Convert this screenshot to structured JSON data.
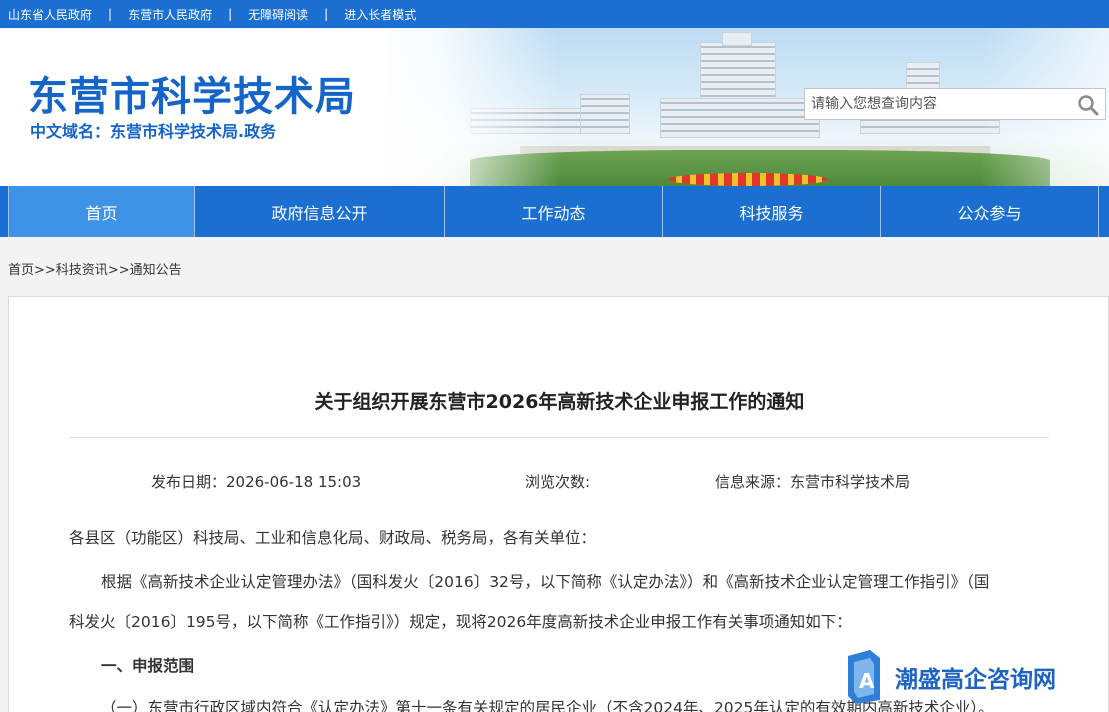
{
  "topbar": {
    "links": [
      "山东省人民政府",
      "东营市人民政府",
      "无障碍阅读",
      "进入长者模式"
    ],
    "separator": "|"
  },
  "header": {
    "site_title": "东营市科学技术局",
    "domain_label": "中文域名：东营市科学技术局.政务",
    "search_placeholder": "请输入您想查询内容"
  },
  "nav": {
    "items": [
      {
        "label": "首页",
        "active": true
      },
      {
        "label": "政府信息公开",
        "active": false
      },
      {
        "label": "工作动态",
        "active": false
      },
      {
        "label": "科技服务",
        "active": false
      },
      {
        "label": "公众参与",
        "active": false
      }
    ]
  },
  "breadcrumb": [
    "首页",
    ">>科技资讯",
    ">>通知公告"
  ],
  "article": {
    "title": "关于组织开展东营市2026年高新技术企业申报工作的通知",
    "publish_date": "发布日期：2026-06-18 15:03",
    "views": "浏览次数:",
    "source": "信息来源：东营市科学技术局",
    "paragraphs": [
      "各县区（功能区）科技局、工业和信息化局、财政局、税务局，各有关单位：",
      "根据《高新技术企业认定管理办法》（国科发火〔2016〕32号，以下简称《认定办法》）和《高新技术企业认定管理工作指引》（国",
      "科发火〔2016〕195号，以下简称《工作指引》）规定，现将2026年度高新技术企业申报工作有关事项通知如下：",
      "一、申报范围",
      "（一）东营市行政区域内符合《认定办法》第十一条有关规定的居民企业（不含2024年、2025年认定的有效期内高新技术企业）。"
    ]
  },
  "watermark": {
    "text": "潮盛高企咨询网"
  },
  "colors": {
    "primary": "#1b6fd0",
    "nav_active": "#3f93e6",
    "title_blue": "#1565c8"
  }
}
